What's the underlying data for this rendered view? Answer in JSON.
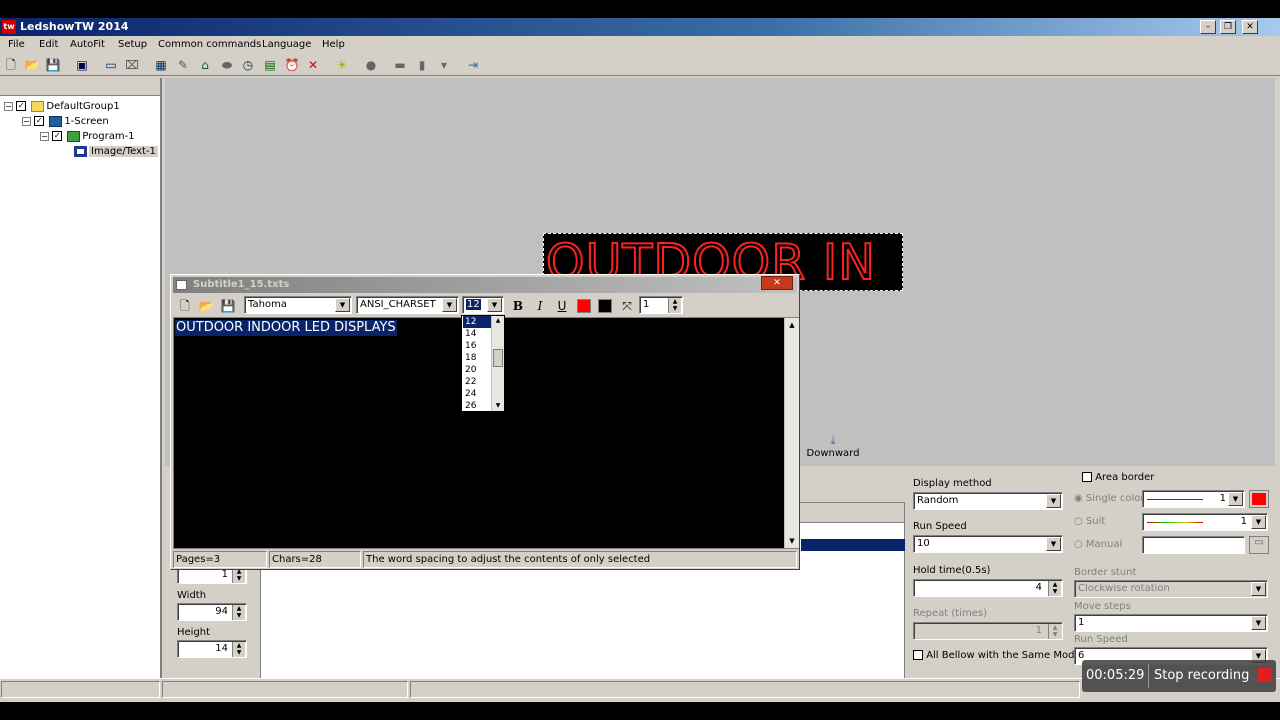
{
  "window": {
    "title": "LedshowTW 2014",
    "app_icon_text": "tw",
    "min": "–",
    "max": "❐",
    "close": "✕"
  },
  "menu": [
    "File",
    "Edit",
    "AutoFit",
    "Setup",
    "Common commands",
    "Language",
    "Help"
  ],
  "toolbar_icons": [
    "new-icon",
    "open-icon",
    "save-icon",
    "screen-icon",
    "area-icon",
    "clear-area-icon",
    "image-text-icon",
    "note-icon",
    "house-icon",
    "oval-icon",
    "clock-icon",
    "calendar-icon",
    "alarm-icon",
    "delete-icon",
    "brightness-icon",
    "stop-icon",
    "send-icon",
    "usb-icon",
    "mic-icon",
    "exit-icon"
  ],
  "tree": {
    "group": "DefaultGroup1",
    "screen": "1-Screen",
    "program": "Program-1",
    "item": "Image/Text-1"
  },
  "led_preview": {
    "text": "OUTDOOR IN",
    "color": "#ff2020"
  },
  "downward": {
    "label": "Downward",
    "icon": "download-icon"
  },
  "dialog": {
    "title": "Subtitle1_15.txts",
    "close": "✕",
    "font_name": "Tahoma",
    "charset": "ANSI_CHARSET",
    "font_size": "12",
    "bold": "B",
    "italic": "I",
    "underline": "U",
    "fore_color": "#ff0000",
    "back_color": "#000000",
    "spacing_value": "1",
    "text": "OUTDOOR INDOOR LED DISPLAYS",
    "status": {
      "pages": "Pages=3",
      "chars": "Chars=28",
      "hint": "The word spacing to adjust the contents of only selected"
    }
  },
  "size_options": [
    "12",
    "14",
    "16",
    "18",
    "20",
    "22",
    "24",
    "26"
  ],
  "size_selected": "12",
  "geometry_fields": {
    "top_value": "1",
    "width_label": "Width",
    "width_value": "94",
    "height_label": "Height",
    "height_value": "14"
  },
  "display": {
    "method_label": "Display method",
    "method_value": "Random",
    "speed_label": "Run Speed",
    "speed_value": "10",
    "hold_label": "Hold time(0.5s)",
    "hold_value": "4",
    "repeat_label": "Repeat (times)",
    "repeat_value": "1",
    "same_mode_label": "All Bellow with the Same Mode"
  },
  "border": {
    "area_border_label": "Area border",
    "single_color_label": "Single color",
    "single_value": "1",
    "suit_label": "Suit",
    "suit_value": "1",
    "manual_label": "Manual",
    "stunt_label": "Border stunt",
    "stunt_value": "Clockwise rotation",
    "move_steps_label": "Move steps",
    "move_steps_value": "1",
    "run_speed_label": "Run Speed",
    "run_speed_value": "6",
    "color": "#ff0000"
  },
  "recorder": {
    "time": "00:05:29",
    "label": "Stop recording"
  }
}
